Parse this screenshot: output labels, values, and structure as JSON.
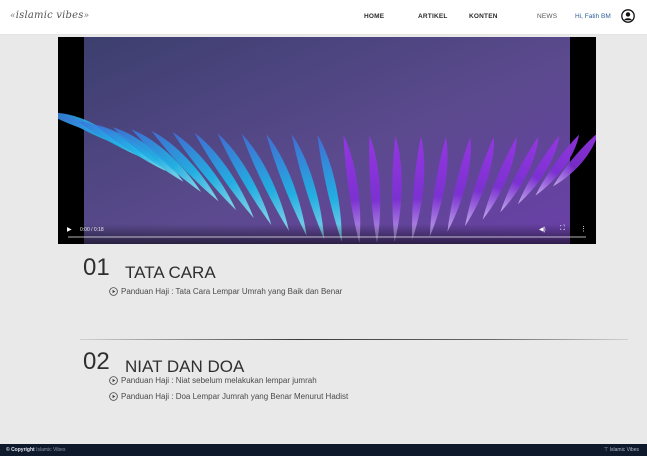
{
  "header": {
    "logo_text": "islamic vibes",
    "nav": [
      "HOME",
      "ARTIKEL",
      "KONTEN",
      "NEWS"
    ],
    "greeting": "Hi, Fatih BM"
  },
  "video": {
    "time": "0:00 / 0:18",
    "progress": 0,
    "icons": [
      "play-icon",
      "volume-icon",
      "fullscreen-icon",
      "more-icon"
    ]
  },
  "sections": [
    {
      "number": "01",
      "title": "TATA CARA",
      "items": [
        "Panduan Haji : Tata Cara Lempar Umrah yang Baik dan Benar"
      ]
    },
    {
      "number": "02",
      "title": "NIAT DAN DOA",
      "items": [
        "Panduan Haji : Niat sebelum melakukan lempar jumrah",
        "Panduan Haji : Doa Lempar Jumrah yang Benar Menurut Hadist"
      ]
    }
  ],
  "footer": {
    "left_bold": "© Copyright",
    "left_muted": "Islamic Vibes",
    "right": "Islamic Vibes"
  },
  "colors": {
    "accent": "#2d5e9a",
    "footer_bg": "#0e1a2c",
    "page_bg": "#e9e9e9"
  }
}
